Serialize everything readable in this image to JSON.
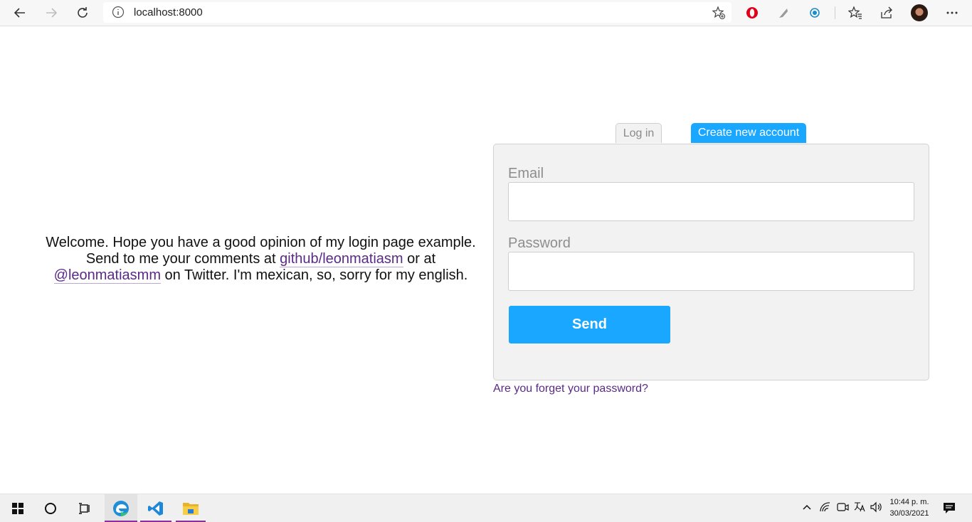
{
  "browser": {
    "url": "localhost:8000"
  },
  "welcome": {
    "line1": "Welcome. Hope you have a good opinion of my login page example.",
    "line2_prefix": "Send to me your comments at ",
    "github_link": "github/leonmatiasm",
    "line2_suffix": " or at",
    "twitter_link": "@leonmatiasmm",
    "line3_suffix": " on Twitter. I'm mexican, so, sorry for my english."
  },
  "tabs": {
    "login": "Log in",
    "create": "Create new account"
  },
  "form": {
    "email_label": "Email",
    "email_value": "",
    "password_label": "Password",
    "password_value": "",
    "send_label": "Send"
  },
  "forgot_link": "Are you forget your password?",
  "taskbar": {
    "time": "10:44 p. m.",
    "date": "30/03/2021"
  },
  "colors": {
    "accent": "#1aa7ff",
    "link": "#5b2a86",
    "panel": "#f2f2f2"
  }
}
